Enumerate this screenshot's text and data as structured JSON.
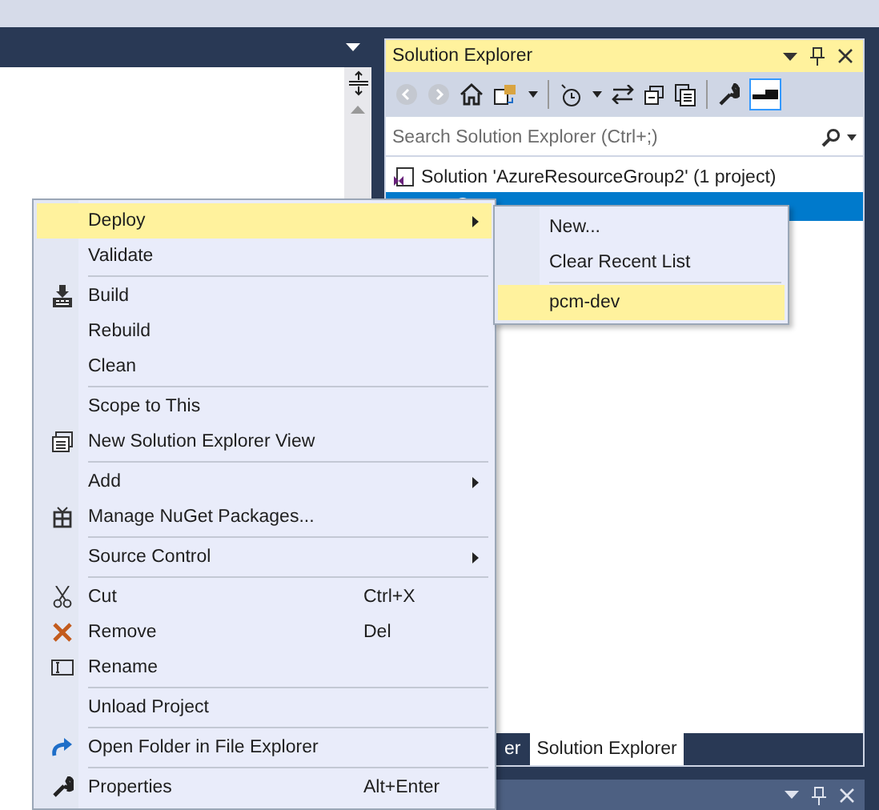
{
  "solution_explorer": {
    "title": "Solution Explorer",
    "search": {
      "placeholder": "Search Solution Explorer (Ctrl+;)"
    },
    "tree": [
      {
        "label": "Solution 'AzureResourceGroup2' (1 project)",
        "selected": false
      },
      {
        "selected": true
      }
    ],
    "tabs": [
      {
        "label": "er",
        "selected": false
      },
      {
        "label": "Solution Explorer",
        "selected": true
      }
    ]
  },
  "context_menu": [
    {
      "kind": "item",
      "label": "Deploy",
      "submenu": true,
      "highlighted": true
    },
    {
      "kind": "item",
      "label": "Validate",
      "submenu": false,
      "highlighted": false
    },
    {
      "kind": "separator"
    },
    {
      "kind": "item",
      "label": "Build",
      "submenu": false,
      "highlighted": false
    },
    {
      "kind": "item",
      "label": "Rebuild",
      "submenu": false,
      "highlighted": false
    },
    {
      "kind": "item",
      "label": "Clean",
      "submenu": false,
      "highlighted": false
    },
    {
      "kind": "separator"
    },
    {
      "kind": "item",
      "label": "Scope to This",
      "submenu": false,
      "highlighted": false
    },
    {
      "kind": "item",
      "label": "New Solution Explorer View",
      "submenu": false,
      "highlighted": false
    },
    {
      "kind": "separator"
    },
    {
      "kind": "item",
      "label": "Add",
      "submenu": true,
      "highlighted": false
    },
    {
      "kind": "item",
      "label": "Manage NuGet Packages...",
      "submenu": false,
      "highlighted": false
    },
    {
      "kind": "separator"
    },
    {
      "kind": "item",
      "label": "Source Control",
      "submenu": true,
      "highlighted": false
    },
    {
      "kind": "separator"
    },
    {
      "kind": "item",
      "label": "Cut",
      "shortcut": "Ctrl+X",
      "submenu": false,
      "highlighted": false
    },
    {
      "kind": "item",
      "label": "Remove",
      "shortcut": "Del",
      "submenu": false,
      "highlighted": false
    },
    {
      "kind": "item",
      "label": "Rename",
      "submenu": false,
      "highlighted": false
    },
    {
      "kind": "separator"
    },
    {
      "kind": "item",
      "label": "Unload Project",
      "submenu": false,
      "highlighted": false
    },
    {
      "kind": "separator"
    },
    {
      "kind": "item",
      "label": "Open Folder in File Explorer",
      "submenu": false,
      "highlighted": false
    },
    {
      "kind": "separator"
    },
    {
      "kind": "item",
      "label": "Properties",
      "shortcut": "Alt+Enter",
      "submenu": false,
      "highlighted": false
    }
  ],
  "deploy_submenu": [
    {
      "kind": "item",
      "label": "New...",
      "highlighted": false
    },
    {
      "kind": "item",
      "label": "Clear Recent List",
      "highlighted": false
    },
    {
      "kind": "separator"
    },
    {
      "kind": "item",
      "label": "pcm-dev",
      "highlighted": true
    }
  ]
}
